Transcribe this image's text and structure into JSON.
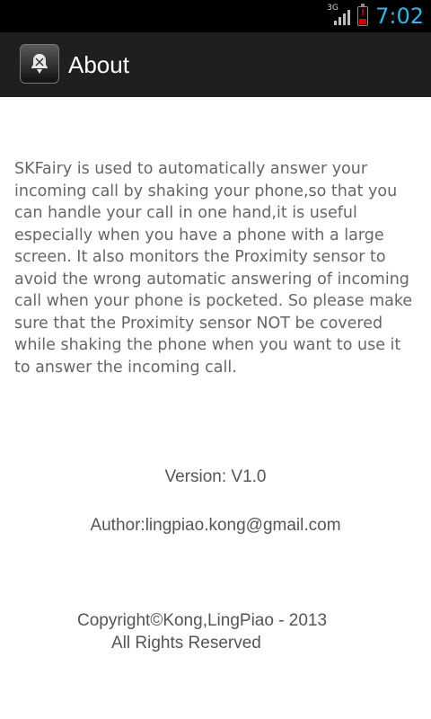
{
  "status_bar": {
    "network_type": "3G",
    "time": "7:02",
    "clock_color": "#33b5e5",
    "battery_color": "#cc0000",
    "icons": [
      "signal-icon",
      "battery-low-icon"
    ]
  },
  "action_bar": {
    "title": "About",
    "icon": "app-logo-icon",
    "background": "#1f1f1f"
  },
  "about": {
    "description": "SKFairy is used to automatically answer your incoming call by shaking your phone,so that you can handle your call in one hand,it is useful especially when you have a phone with a large screen. It also monitors the Proximity sensor to avoid the wrong automatic answering of incoming call when your phone is pocketed. So please make sure that the Proximity sensor NOT be covered while shaking the phone when you want to use it to answer the incoming call.",
    "version": "Version: V1.0",
    "author": "Author:lingpiao.kong@gmail.com",
    "copyright_line1": "Copyright©Kong,LingPiao - 2013",
    "copyright_line2": "All Rights Reserved"
  }
}
